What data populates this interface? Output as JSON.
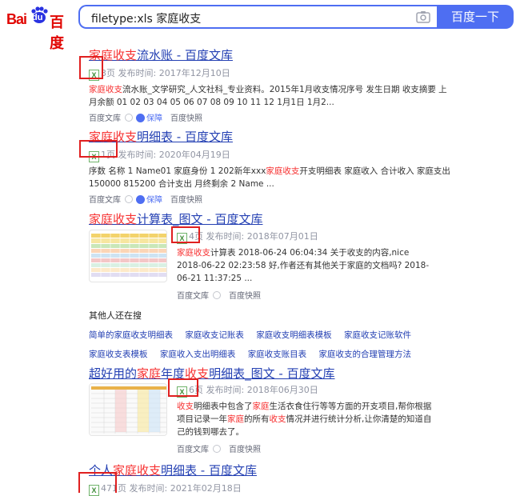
{
  "header": {
    "logo_bai": "Bai",
    "logo_du": "du",
    "logo_baidu": "百度",
    "query": "filetype:xls 家庭收支",
    "search_button": "百度一下"
  },
  "results": [
    {
      "title_hl": "家庭收支",
      "title_rest": "流水账 - 百度文库",
      "pages": "3页",
      "date": "发布时间: 2017年12月10日",
      "abstract_hl": "家庭收支",
      "abstract_rest": "流水账_文学研究_人文社科_专业资料。2015年1月收支情况序号 发生日期 收支摘要 上月余额 01 02 03 04 05 06 07 08 09 10 11 12 1月1日 1月2...",
      "source": "百度文库",
      "badge": "保障",
      "snapshot": "百度快照"
    },
    {
      "title_hl": "家庭收支",
      "title_rest": "明细表 - 百度文库",
      "pages": "1页",
      "date": "发布时间: 2020年04月19日",
      "abstract_pre": "序数 名称 1 Name01 家庭身份 1 202新年xxx",
      "abstract_hl": "家庭收支",
      "abstract_rest": "开支明细表 家庭收入 合计收入 家庭支出 150000 815200 合计支出 月终剩余 2 Name ...",
      "source": "百度文库",
      "badge": "保障",
      "snapshot": "百度快照"
    },
    {
      "title_hl": "家庭收支",
      "title_rest": "计算表_图文 - 百度文库",
      "pages": "4页",
      "date": "发布时间: 2018年07月01日",
      "abstract_hl": "家庭收支",
      "abstract_rest": "计算表 2018-06-24 06:04:34 关于收支的内容,nice 2018-06-22 02:23:58 好,作者还有其他关于家庭的文档吗? 2018-06-21 11:37:25 ...",
      "source": "百度文库",
      "snapshot": "百度快照"
    },
    {
      "title_pre": "超好用的",
      "title_hl1": "家庭",
      "title_mid": "年度",
      "title_hl2": "收支",
      "title_rest": "明细表_图文 - 百度文库",
      "pages": "6页",
      "date": "发布时间: 2018年06月30日",
      "abstract_hl1": "收支",
      "abstract_t1": "明细表中包含了",
      "abstract_hl2": "家庭",
      "abstract_t2": "生活衣食住行等等方面的开支项目,帮你根据项目记录一年",
      "abstract_hl3": "家庭",
      "abstract_t3": "的所有",
      "abstract_hl4": "收支",
      "abstract_t4": "情况并进行统计分析,让你清楚的知道自己的钱到哪去了。",
      "source": "百度文库",
      "snapshot": "百度快照"
    },
    {
      "title_pre": "个人",
      "title_hl": "家庭收支",
      "title_rest": "明细表 - 百度文库",
      "pages": "471页",
      "date": "发布时间: 2021年02月18日"
    }
  ],
  "related": {
    "heading": "其他人还在搜",
    "row1": [
      "简单的家庭收支明细表",
      "家庭收支记账表",
      "家庭收支明细表模板",
      "家庭收支记账软件"
    ],
    "row2": [
      "家庭收支表模板",
      "家庭收入支出明细表",
      "家庭收支账目表",
      "家庭收支的合理管理方法"
    ]
  },
  "icons": {
    "xls": "X"
  },
  "colors": {
    "accent": "#4e6ef2",
    "link": "#2440b3",
    "highlight": "#f73131",
    "annotation": "#e02020"
  }
}
